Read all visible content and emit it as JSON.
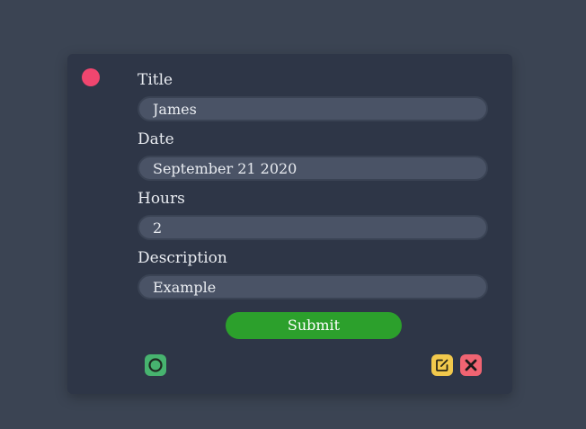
{
  "form": {
    "fields": [
      {
        "label": "Title",
        "value": "James"
      },
      {
        "label": "Date",
        "value": "September 21 2020"
      },
      {
        "label": "Hours",
        "value": "2"
      },
      {
        "label": "Description",
        "value": "Example"
      }
    ],
    "submit_label": "Submit"
  },
  "icons": {
    "status": "status-dot-icon",
    "left_action": "circle-icon",
    "edit": "edit-icon",
    "close": "close-icon"
  },
  "colors": {
    "page_background": "#3b4453",
    "card_background": "#2e3647",
    "status_dot": "#f0466f",
    "input_background": "#4a5366",
    "submit": "#2ca02c",
    "circle_button": "#47b36f",
    "edit_button": "#f2c94c",
    "close_button": "#f06472"
  }
}
